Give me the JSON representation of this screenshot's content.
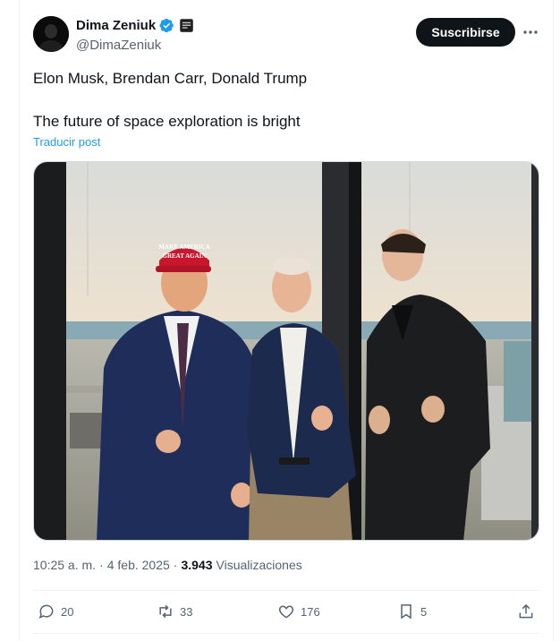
{
  "author": {
    "display_name": "Dima Zeniuk",
    "handle": "@DimaZeniuk",
    "verified_icon": "verified-badge-icon",
    "affiliation_icon": "affiliate-badge-icon"
  },
  "header": {
    "subscribe_label": "Suscribirse",
    "more_icon": "more-horizontal-icon"
  },
  "post": {
    "line1": "Elon Musk, Brendan Carr, Donald Trump",
    "line2": "The future of space exploration is bright",
    "translate_label": "Traducir post",
    "photo_hat_text_1": "MAKE AMERICA",
    "photo_hat_text_2": "GREAT AGAIN"
  },
  "meta": {
    "time": "10:25 a. m.",
    "separator": "·",
    "date": "4 feb. 2025",
    "views_count": "3.943",
    "views_label": "Visualizaciones"
  },
  "actions": {
    "replies": "20",
    "reposts": "33",
    "likes": "176",
    "bookmarks": "5"
  },
  "colors": {
    "accent": "#1d9bf0",
    "text_primary": "#0f1419",
    "text_secondary": "#536471",
    "divider": "#eff3f4"
  }
}
